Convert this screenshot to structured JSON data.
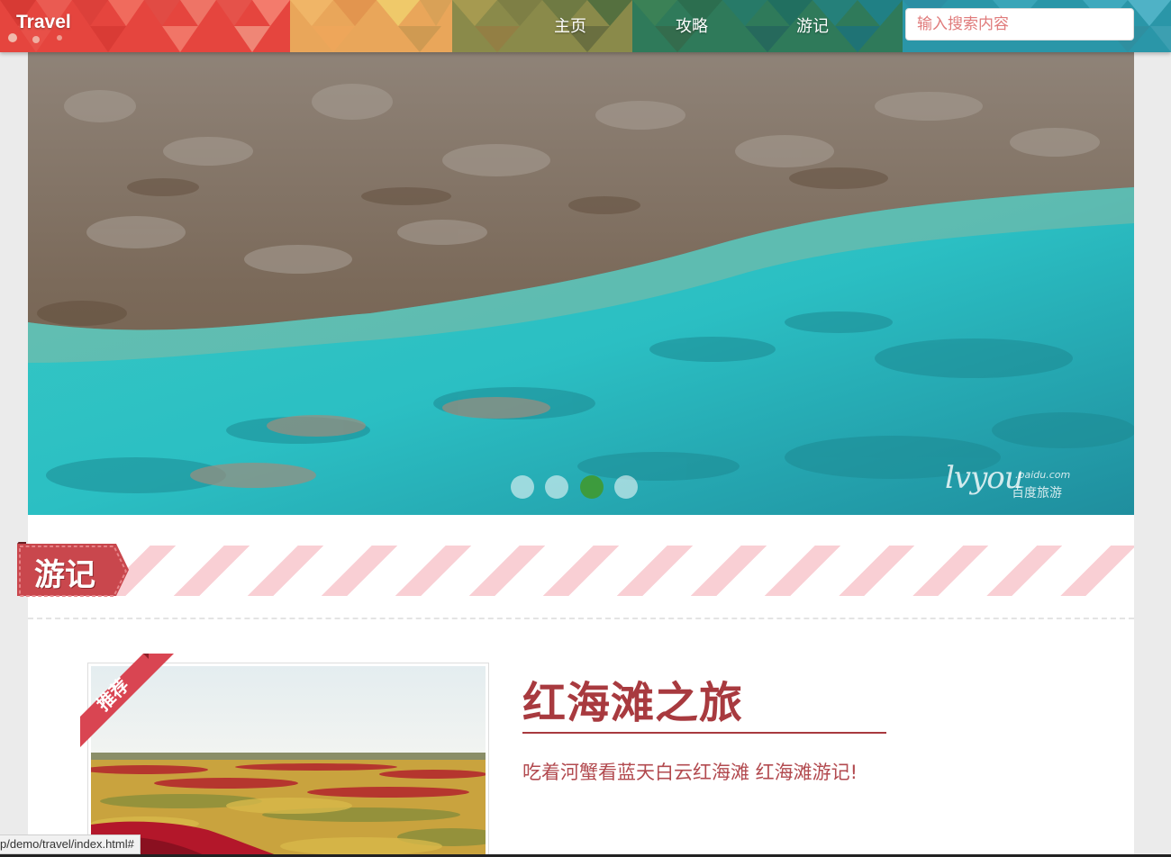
{
  "header": {
    "logo": "Travel",
    "nav": [
      {
        "label": "主页"
      },
      {
        "label": "攻略"
      },
      {
        "label": "游记"
      }
    ],
    "search": {
      "placeholder": "输入搜索内容",
      "value": ""
    }
  },
  "hero": {
    "slides_count": 4,
    "active_slide": 3,
    "watermark": {
      "main": "lvyou",
      "sub": ".baidu.com",
      "cn": "百度旅游"
    }
  },
  "section": {
    "tag": "游记"
  },
  "article": {
    "badge": "推荐",
    "title": "红海滩之旅",
    "summary": "吃着河蟹看蓝天白云红海滩 红海滩游记!"
  },
  "status_bar": {
    "url": "p/demo/travel/index.html#"
  },
  "colors": {
    "accent": "#a83a3f",
    "stripe": "#f9cfd4",
    "active_dot": "#3d9b3d",
    "search_placeholder": "#e07b7b"
  }
}
